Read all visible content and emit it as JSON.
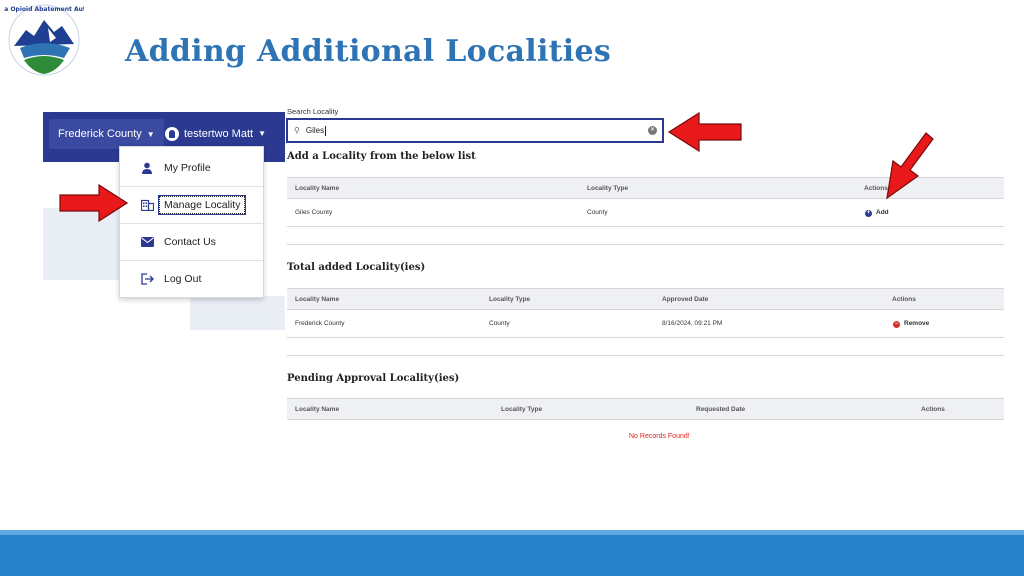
{
  "slide": {
    "title": "Adding Additional Localities",
    "logo_text": "Virginia Opioid Abatement Authority"
  },
  "nav": {
    "county": "Frederick County",
    "user": "testertwo Matt"
  },
  "user_menu": [
    {
      "label": "My Profile",
      "icon": "person-icon"
    },
    {
      "label": "Manage Locality",
      "icon": "building-icon"
    },
    {
      "label": "Contact Us",
      "icon": "envelope-icon"
    },
    {
      "label": "Log Out",
      "icon": "logout-icon"
    }
  ],
  "search": {
    "label": "Search Locality",
    "value": "Giles"
  },
  "add_section": {
    "title": "Add a Locality from the below list",
    "headers": [
      "Locality Name",
      "Locality Type",
      "Actions"
    ],
    "rows": [
      {
        "name": "Giles County",
        "type": "County",
        "action": "Add"
      }
    ]
  },
  "added_section": {
    "title": "Total added Locality(ies)",
    "headers": [
      "Locality Name",
      "Locality Type",
      "Approved Date",
      "Actions"
    ],
    "rows": [
      {
        "name": "Frederick County",
        "type": "County",
        "date": "8/16/2024, 09:21 PM",
        "action": "Remove"
      }
    ]
  },
  "pending_section": {
    "title": "Pending Approval Locality(ies)",
    "headers": [
      "Locality Name",
      "Locality Type",
      "Requested Date",
      "Actions"
    ],
    "empty_message": "No Records Found!"
  },
  "colors": {
    "title": "#2e74b5",
    "nav": "#2b3990",
    "arrow": "#e8181b",
    "footer": "#2782c9",
    "remove": "#d0312d"
  }
}
